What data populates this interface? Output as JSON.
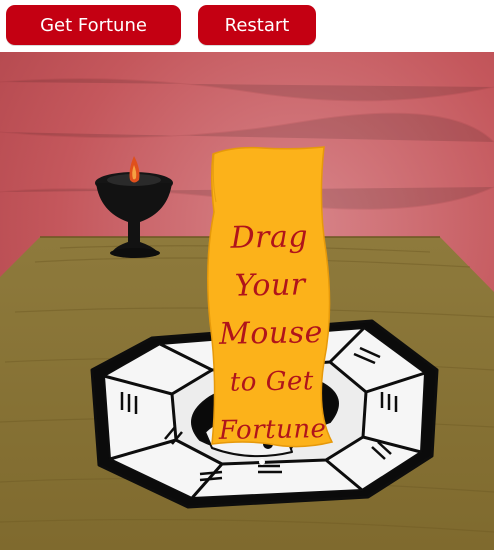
{
  "toolbar": {
    "get_fortune_label": "Get Fortune",
    "restart_label": "Restart"
  },
  "scroll": {
    "lines": [
      "Drag",
      "Your",
      "Mouse",
      "to Get",
      "Fortune"
    ]
  },
  "colors": {
    "button_bg": "#c40012",
    "wall": "#c4575c",
    "table": "#8a7336",
    "scroll": "#fcb21a",
    "ink": "#b0141b",
    "candle_flame": "#e0501c",
    "bowl": "#111111"
  }
}
